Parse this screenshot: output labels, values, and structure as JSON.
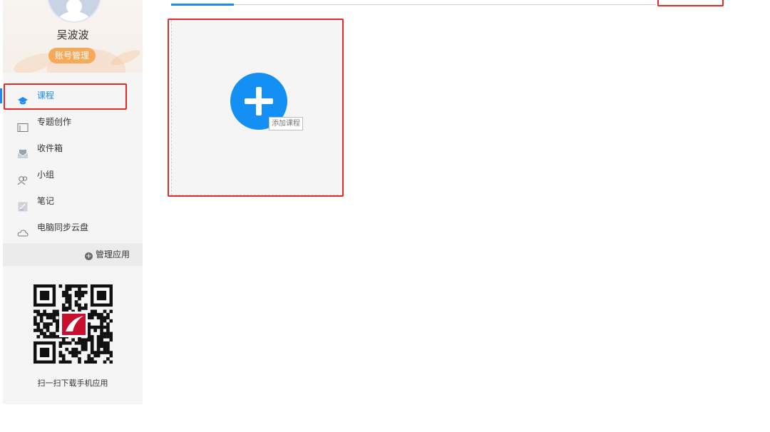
{
  "profile": {
    "username": "吴波波",
    "account_button": "账号管理"
  },
  "nav": {
    "items": [
      {
        "label": "课程",
        "icon": "graduation-cap-icon",
        "active": true
      },
      {
        "label": "专题创作",
        "icon": "window-icon",
        "active": false
      },
      {
        "label": "收件箱",
        "icon": "inbox-icon",
        "active": false
      },
      {
        "label": "小组",
        "icon": "group-icon",
        "active": false
      },
      {
        "label": "笔记",
        "icon": "note-icon",
        "active": false
      },
      {
        "label": "电脑同步云盘",
        "icon": "cloud-icon",
        "active": false
      }
    ],
    "manage_apps": "管理应用"
  },
  "qr": {
    "caption": "扫一扫下载手机应用"
  },
  "main": {
    "add_course_tooltip": "添加课程"
  },
  "colors": {
    "accent": "#1a8cf0",
    "highlight_box": "#e42a2a",
    "account_button": "#f7a95a",
    "add_button": "#1490f5"
  }
}
